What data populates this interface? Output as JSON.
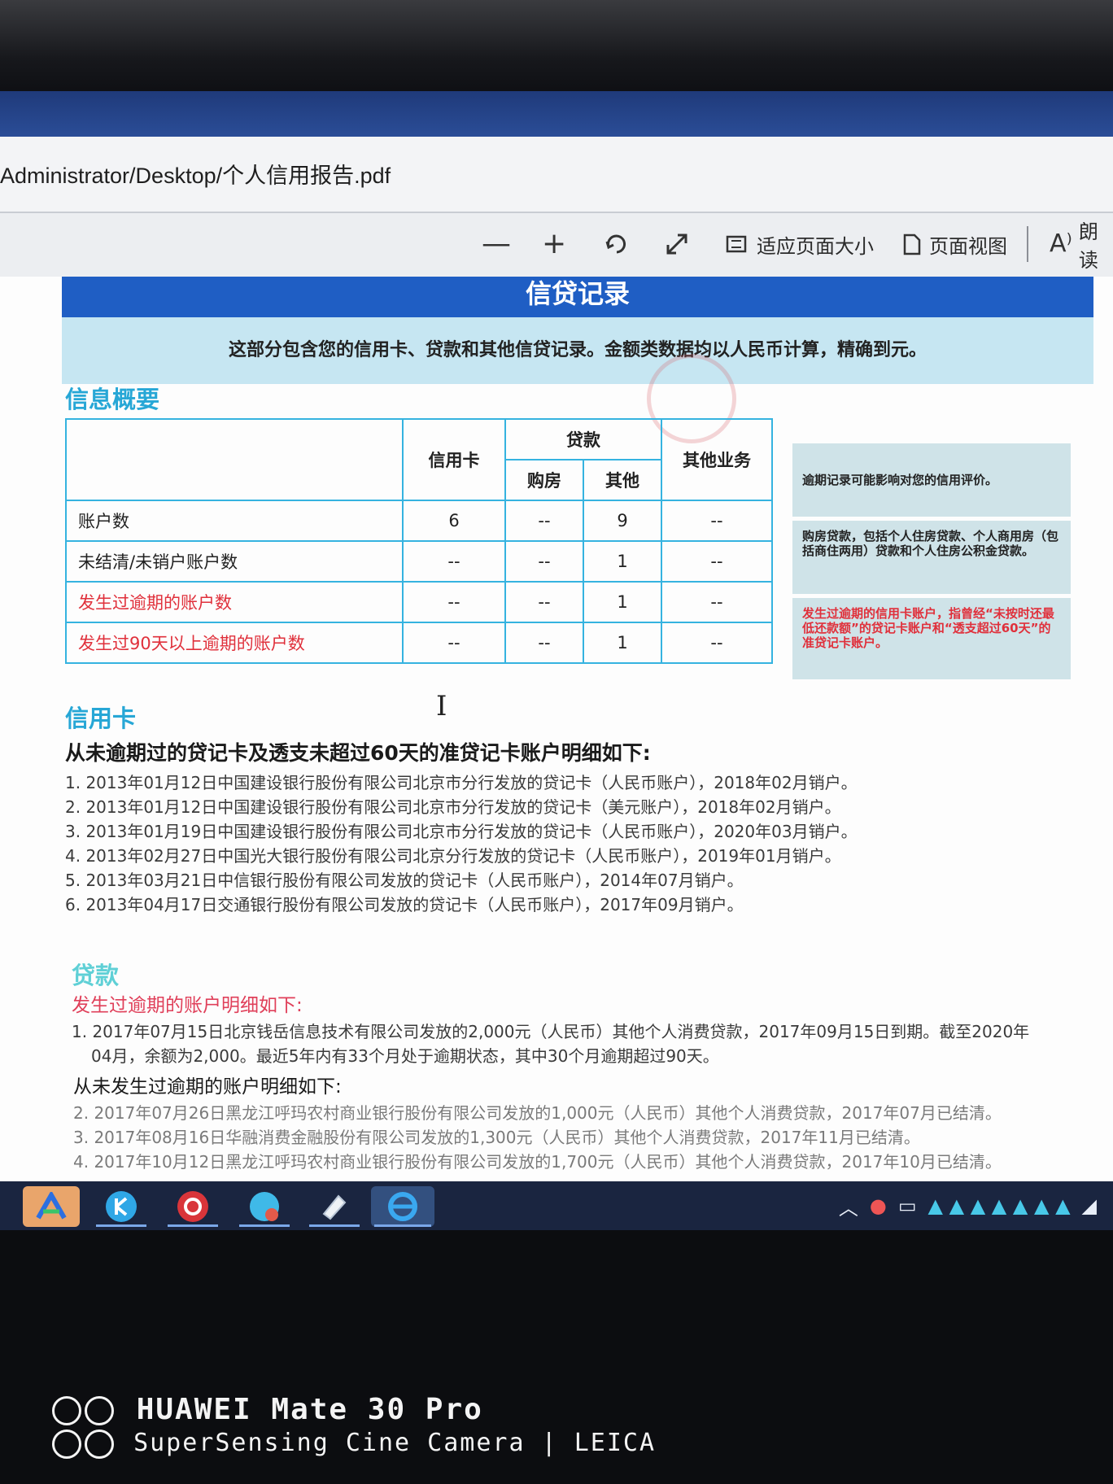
{
  "window": {
    "path": "Administrator/Desktop/个人信用报告.pdf"
  },
  "toolbar": {
    "zoom_out": "—",
    "zoom_in": "+",
    "fit_page_label": "适应页面大小",
    "page_view_label": "页面视图",
    "read_aloud_label": "朗读"
  },
  "document": {
    "banner_title": "信贷记录",
    "banner_subtitle": "这部分包含您的信用卡、贷款和其他信贷记录。金额类数据均以人民币计算，精确到元。",
    "summary": {
      "heading": "信息概要",
      "headers": {
        "credit_card": "信用卡",
        "loan": "贷款",
        "home": "购房",
        "other": "其他",
        "other_business": "其他业务"
      },
      "rows": [
        {
          "label": "账户数",
          "red": false,
          "cells": [
            "6",
            "--",
            "9",
            "--"
          ]
        },
        {
          "label": "未结清/未销户账户数",
          "red": false,
          "cells": [
            "--",
            "--",
            "1",
            "--"
          ]
        },
        {
          "label": "发生过逾期的账户数",
          "red": true,
          "cells": [
            "--",
            "--",
            "1",
            "--"
          ]
        },
        {
          "label": "发生过90天以上逾期的账户数",
          "red": true,
          "cells": [
            "--",
            "--",
            "1",
            "--"
          ]
        }
      ],
      "notes": [
        "逾期记录可能影响对您的信用评价。",
        "购房贷款，包括个人住房贷款、个人商用房（包括商住两用）贷款和个人住房公积金贷款。",
        "发生过逾期的信用卡账户，指曾经“未按时还最低还款额”的贷记卡账户和“透支超过60天”的准贷记卡账户。"
      ]
    },
    "credit_card": {
      "heading": "信用卡",
      "intro": "从未逾期过的贷记卡及透支未超过60天的准贷记卡账户明细如下:",
      "items": [
        "1. 2013年01月12日中国建设银行股份有限公司北京市分行发放的贷记卡（人民币账户），2018年02月销户。",
        "2. 2013年01月12日中国建设银行股份有限公司北京市分行发放的贷记卡（美元账户），2018年02月销户。",
        "3. 2013年01月19日中国建设银行股份有限公司北京市分行发放的贷记卡（人民币账户），2020年03月销户。",
        "4. 2013年02月27日中国光大银行股份有限公司北京分行发放的贷记卡（人民币账户），2019年01月销户。",
        "5. 2013年03月21日中信银行股份有限公司发放的贷记卡（人民币账户），2014年07月销户。",
        "6. 2013年04月17日交通银行股份有限公司发放的贷记卡（人民币账户），2017年09月销户。"
      ]
    },
    "loan": {
      "heading": "贷款",
      "overdue_heading": "发生过逾期的账户明细如下:",
      "overdue_items": [
        "1. 2017年07月15日北京钱岳信息技术有限公司发放的2,000元（人民币）其他个人消费贷款，2017年09月15日到期。截至2020年",
        "04月，余额为2,000。最近5年内有33个月处于逾期状态，其中30个月逾期超过90天。"
      ],
      "never_overdue_heading": "从未发生过逾期的账户明细如下:",
      "never_overdue_items": [
        "2. 2017年07月26日黑龙江呼玛农村商业银行股份有限公司发放的1,000元（人民币）其他个人消费贷款，2017年07月已结清。",
        "3. 2017年08月16日华融消费金融股份有限公司发放的1,300元（人民币）其他个人消费贷款，2017年11月已结清。",
        "4. 2017年10月12日黑龙江呼玛农村商业银行股份有限公司发放的1,700元（人民币）其他个人消费贷款，2017年10月已结清。"
      ]
    }
  },
  "camera_watermark": {
    "line1": "HUAWEI Mate 30 Pro",
    "line2": "SuperSensing Cine Camera | LEICA"
  },
  "colors": {
    "banner": "#1f5ec4",
    "accent": "#27a7d6",
    "warning": "#e0303b"
  }
}
